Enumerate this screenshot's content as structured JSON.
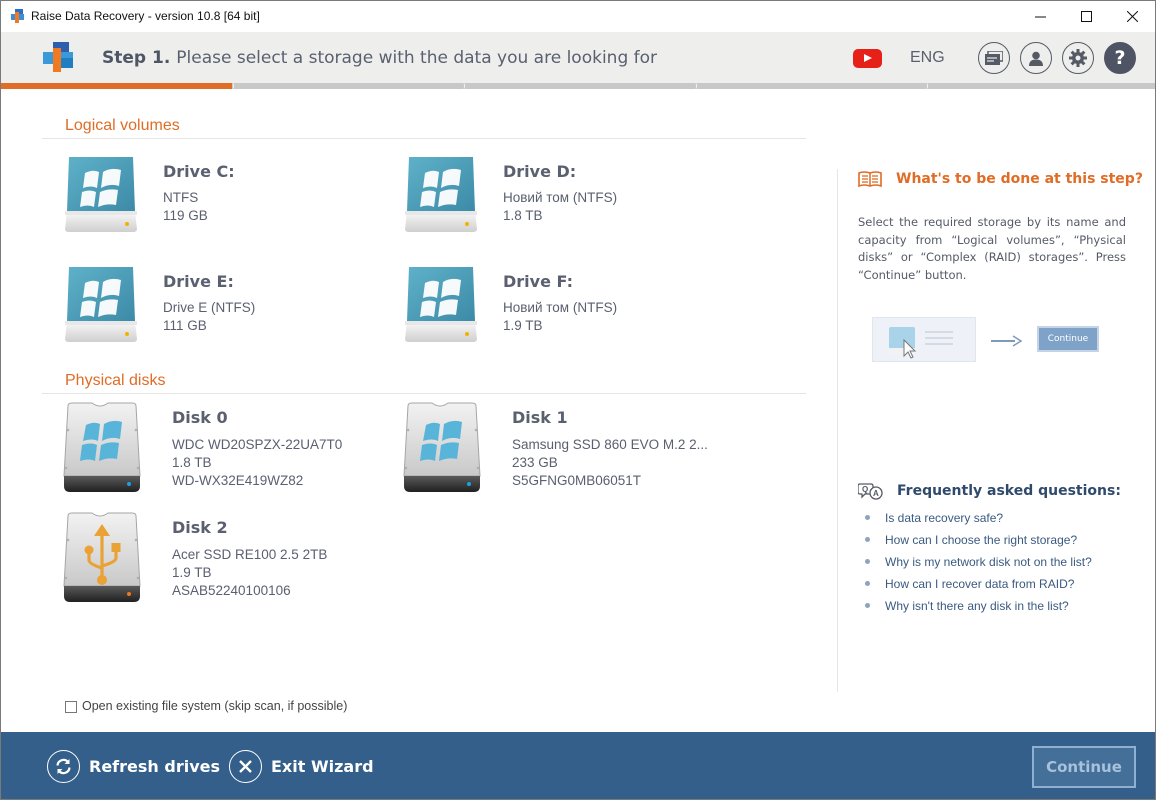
{
  "window": {
    "title": "Raise Data Recovery - version 10.8 [64 bit]",
    "controls": [
      "minimize",
      "maximize",
      "close"
    ]
  },
  "header": {
    "step_label": "Step 1.",
    "step_text": "Please select a storage with the data you are looking for",
    "language": "ENG",
    "icons": [
      "youtube-icon",
      "messages-icon",
      "account-icon",
      "settings-icon",
      "help-icon"
    ]
  },
  "progress": {
    "current_step": 1,
    "total_steps": 5
  },
  "logical_volumes": {
    "title": "Logical volumes",
    "items": [
      {
        "name": "Drive C:",
        "fs": "NTFS",
        "size": "119 GB"
      },
      {
        "name": "Drive D:",
        "fs": "Новий том (NTFS)",
        "size": "1.8 TB"
      },
      {
        "name": "Drive E:",
        "fs": "Drive E (NTFS)",
        "size": "111 GB"
      },
      {
        "name": "Drive F:",
        "fs": "Новий том (NTFS)",
        "size": "1.9 TB"
      }
    ]
  },
  "physical_disks": {
    "title": "Physical disks",
    "items": [
      {
        "name": "Disk 0",
        "model": "WDC WD20SPZX-22UA7T0",
        "size": "1.8 TB",
        "serial": "WD-WX32E419WZ82",
        "type": "windows"
      },
      {
        "name": "Disk 1",
        "model": "Samsung SSD 860 EVO M.2 2...",
        "size": "233 GB",
        "serial": "S5GFNG0MB06051T",
        "type": "windows"
      },
      {
        "name": "Disk 2",
        "model": "Acer SSD RE100 2.5 2TB",
        "size": "1.9 TB",
        "serial": "ASAB52240100106",
        "type": "usb"
      }
    ]
  },
  "help": {
    "title": "What's to be done at this step?",
    "text": "Select the required storage by its name and capacity from “Logical volumes”, “Physical disks” or “Complex (RAID) storages”. Press “Continue” button.",
    "illustration_button": "Continue"
  },
  "faq": {
    "title": "Frequently asked questions:",
    "items": [
      "Is data recovery safe?",
      "How can I choose the right storage?",
      "Why is my network disk not on the list?",
      "How can I recover data from RAID?",
      "Why isn't there any disk in the list?"
    ]
  },
  "options": {
    "open_fs_label": "Open existing file system (skip scan, if possible)",
    "open_fs_checked": false
  },
  "footer": {
    "refresh_label": "Refresh drives",
    "exit_label": "Exit Wizard",
    "continue_label": "Continue",
    "continue_enabled": false
  },
  "colors": {
    "accent_orange": "#e06c26",
    "footer_blue": "#335f8a",
    "faq_link": "#3a5a80",
    "text_gray": "#5a6070"
  }
}
